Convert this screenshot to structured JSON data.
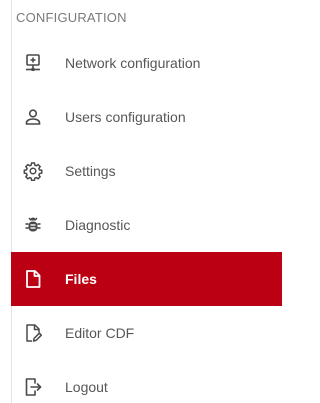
{
  "section": {
    "header": "CONFIGURATION"
  },
  "menu": {
    "items": [
      {
        "label": "Network configuration",
        "icon": "network-icon"
      },
      {
        "label": "Users configuration",
        "icon": "user-icon"
      },
      {
        "label": "Settings",
        "icon": "gear-icon"
      },
      {
        "label": "Diagnostic",
        "icon": "bug-icon"
      },
      {
        "label": "Files",
        "icon": "file-icon",
        "active": true
      },
      {
        "label": "Editor CDF",
        "icon": "file-edit-icon"
      },
      {
        "label": "Logout",
        "icon": "logout-icon"
      }
    ]
  },
  "colors": {
    "active_background": "#bb0014",
    "active_text": "#ffffff",
    "text": "#575757",
    "icon": "#4a4a4a",
    "header_text": "#7a7a7a"
  }
}
